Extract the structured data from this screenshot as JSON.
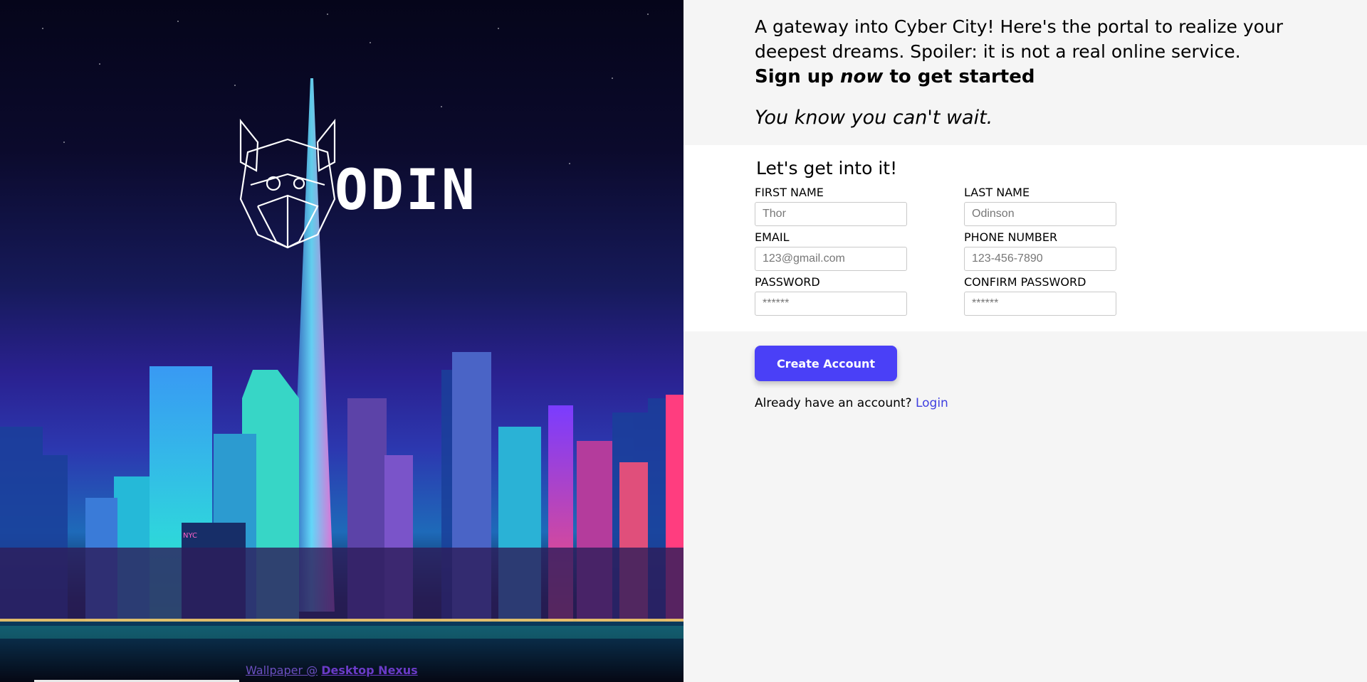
{
  "hero": {
    "logo_text": "ODIN",
    "credit_prefix": "Wallpaper @",
    "credit_site": "Desktop Nexus",
    "building_sign": "NYC"
  },
  "intro": {
    "lead": "A gateway into Cyber City! Here's the portal to realize your deepest dreams. Spoiler: it is not a real online service.",
    "cta_before": "Sign up",
    "cta_emph": "now",
    "cta_after": "to get started",
    "tagline": "You know you can't wait."
  },
  "form": {
    "title": "Let's get into it!",
    "first_name": {
      "label": "FIRST NAME",
      "placeholder": "Thor"
    },
    "last_name": {
      "label": "LAST NAME",
      "placeholder": "Odinson"
    },
    "email": {
      "label": "EMAIL",
      "placeholder": "123@gmail.com"
    },
    "phone": {
      "label": "PHONE NUMBER",
      "placeholder": "123-456-7890"
    },
    "password": {
      "label": "PASSWORD",
      "placeholder": "******"
    },
    "confirm_password": {
      "label": "CONFIRM PASSWORD",
      "placeholder": "******"
    }
  },
  "actions": {
    "create_account": "Create Account",
    "login_prompt": "Already have an account?",
    "login_link": "Login"
  },
  "colors": {
    "accent": "#4a40f7",
    "link": "#3f3fe0",
    "panel_bg": "#f5f5f5",
    "form_bg": "#ffffff"
  }
}
